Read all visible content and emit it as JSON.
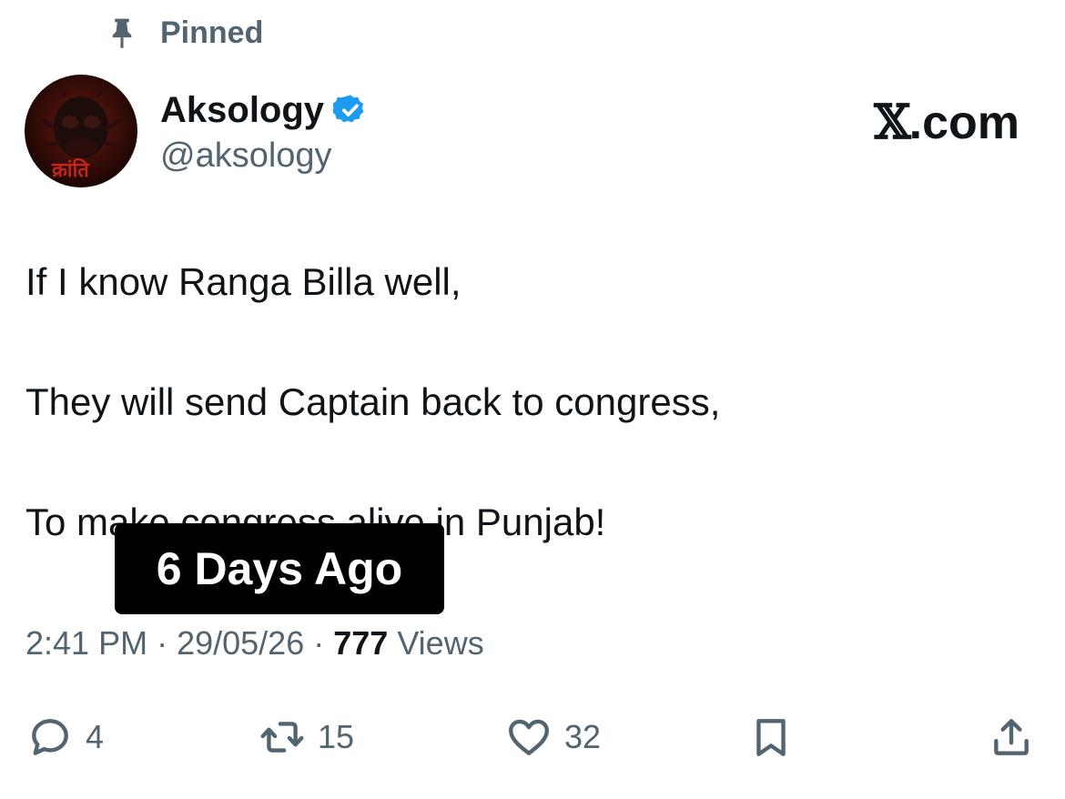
{
  "pinned": {
    "label": "Pinned",
    "icon": "pin-icon"
  },
  "author": {
    "display_name": "Aksology",
    "handle": "@aksology",
    "verified": true,
    "verified_color": "#1d9bf0",
    "avatar_text": "क्रांति"
  },
  "brand": {
    "x": "𝕏",
    "suffix": ".com"
  },
  "tweet": {
    "line1": "If I know Ranga Billa well,",
    "line2": "They will send Captain back to congress,",
    "line3": "To make congress alive in Punjab!"
  },
  "overlay": {
    "text": "6  Days Ago"
  },
  "meta": {
    "time": "2:41 PM",
    "date": "29/05/26",
    "views_count": "777",
    "views_label": "Views",
    "sep": " · "
  },
  "actions": {
    "replies": "4",
    "reposts": "15",
    "likes": "32"
  }
}
